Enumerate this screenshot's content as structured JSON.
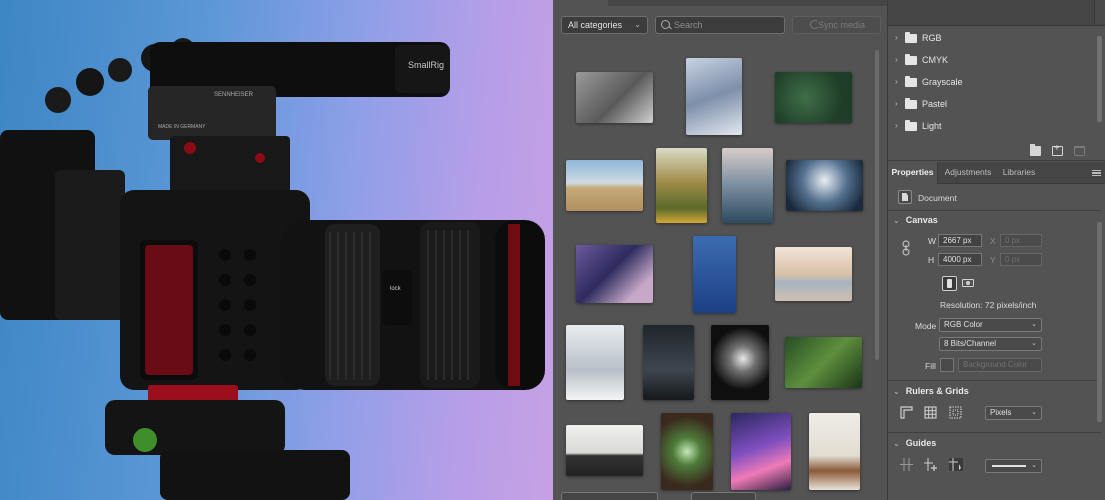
{
  "stock": {
    "category_dropdown": "All categories",
    "search_placeholder": "Search",
    "sync_button": "Sync media"
  },
  "channels": {
    "items": [
      {
        "label": "RGB"
      },
      {
        "label": "CMYK"
      },
      {
        "label": "Grayscale"
      },
      {
        "label": "Pastel"
      },
      {
        "label": "Light"
      }
    ]
  },
  "panel_tabs": {
    "properties": "Properties",
    "adjustments": "Adjustments",
    "libraries": "Libraries"
  },
  "properties": {
    "document_label": "Document",
    "canvas": {
      "title": "Canvas",
      "w_label": "W",
      "w_value": "2667 px",
      "x_label": "X",
      "x_value": "0 px",
      "h_label": "H",
      "h_value": "4000 px",
      "y_label": "Y",
      "y_value": "0 px",
      "resolution": "Resolution: 72 pixels/inch",
      "mode_label": "Mode",
      "mode_value": "RGB Color",
      "depth_value": "8 Bits/Channel",
      "fill_label": "Fill",
      "fill_value": "Background Color"
    },
    "rulers": {
      "title": "Rulers & Grids",
      "units": "Pixels"
    },
    "guides": {
      "title": "Guides"
    }
  },
  "colors": {
    "panel_bg": "#535353",
    "panel_dark": "#454545",
    "text": "#dadada"
  }
}
